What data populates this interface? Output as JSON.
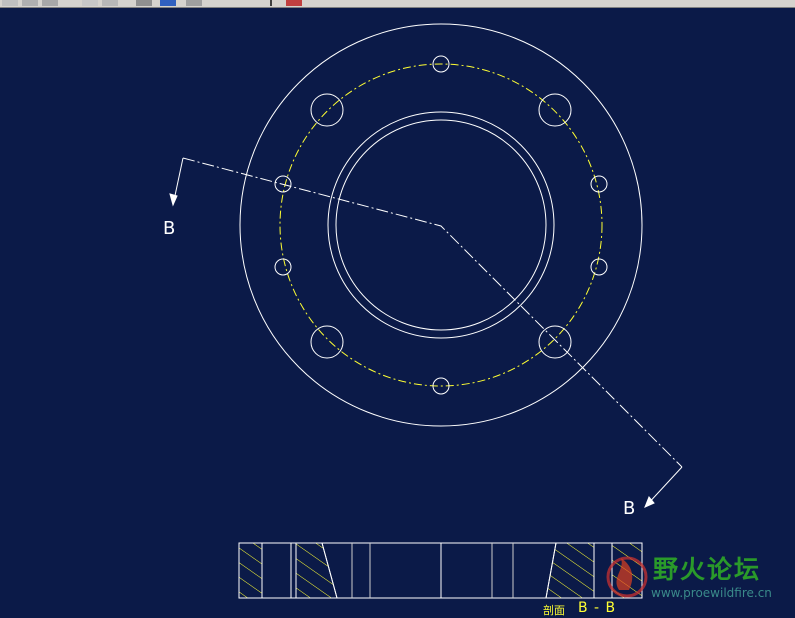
{
  "section_labels": {
    "arrow_top": "B",
    "arrow_bottom": "B",
    "section_prefix": "剖面",
    "section_name": "B - B"
  },
  "watermark": {
    "name": "野火论坛",
    "url": "www.proewildfire.cn"
  },
  "colors": {
    "background": "#0b1a48",
    "geometry": "#ffffff",
    "bolt_circle": "#ffff33",
    "hatch": "#ffff33",
    "watermark_text": "#2a9a2a"
  },
  "icons": [
    "toolbar-icon",
    "flame-logo-icon"
  ]
}
